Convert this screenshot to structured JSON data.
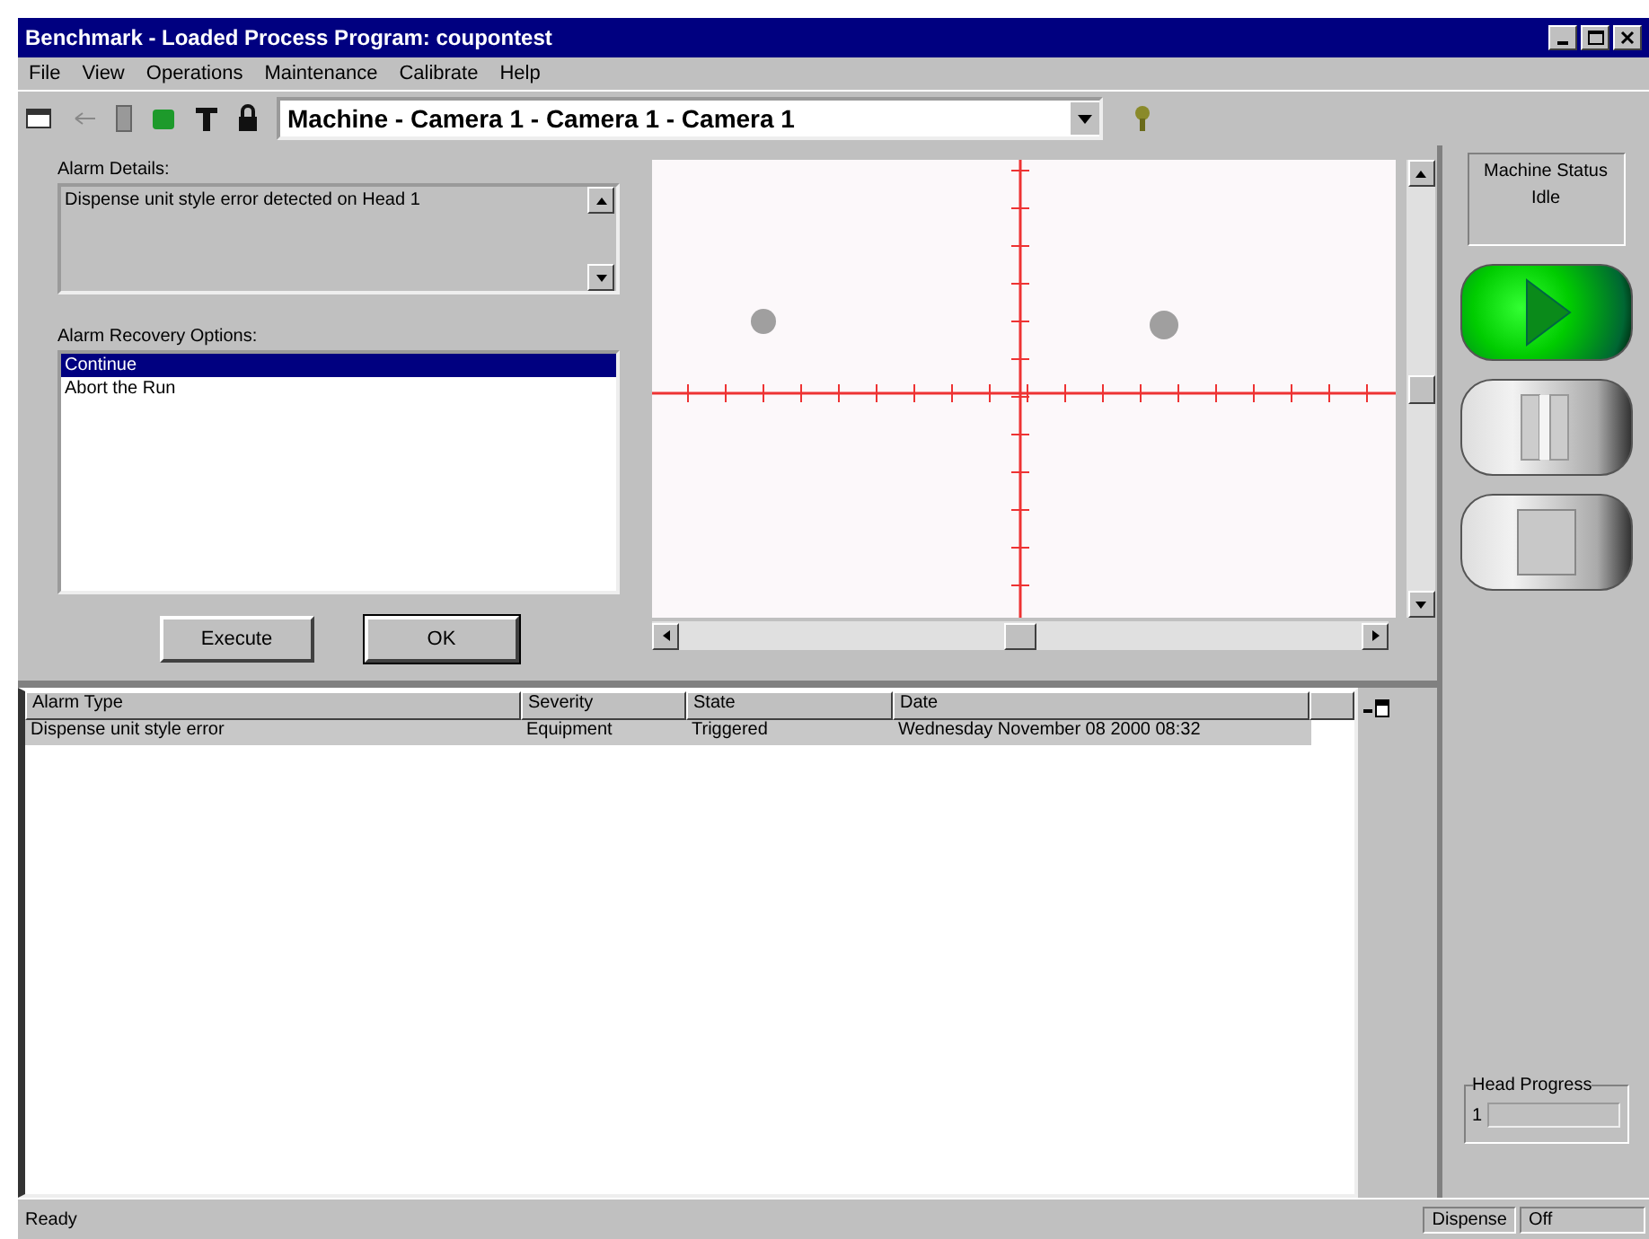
{
  "window": {
    "title": "Benchmark - Loaded Process Program: coupontest"
  },
  "menu": [
    "File",
    "View",
    "Operations",
    "Maintenance",
    "Calibrate",
    "Help"
  ],
  "toolbar": {
    "camera_select": "Machine - Camera 1 - Camera 1 - Camera 1"
  },
  "alarm_details": {
    "label": "Alarm Details:",
    "text": "Dispense unit style error detected on Head 1"
  },
  "recovery": {
    "label": "Alarm Recovery Options:",
    "options": [
      {
        "label": "Continue",
        "selected": true
      },
      {
        "label": "Abort the Run",
        "selected": false
      }
    ]
  },
  "buttons": [
    "Execute",
    "OK"
  ],
  "alarm_table": {
    "columns": [
      "Alarm Type",
      "Severity",
      "State",
      "Date"
    ],
    "rows": [
      {
        "cells": [
          "Dispense unit style error",
          "Equipment",
          "Triggered",
          "Wednesday November 08 2000 08:32"
        ],
        "selected": true
      }
    ]
  },
  "machine_status": {
    "label": "Machine Status",
    "value": "Idle"
  },
  "controls": [
    {
      "kind": "play",
      "selected": true
    },
    {
      "kind": "pause",
      "selected": false
    },
    {
      "kind": "stop",
      "selected": false
    }
  ],
  "head_progress": {
    "label": "Head Progress",
    "head": "1",
    "level": 0
  },
  "status_bar": [
    "Ready",
    "Dispense",
    "Off"
  ]
}
